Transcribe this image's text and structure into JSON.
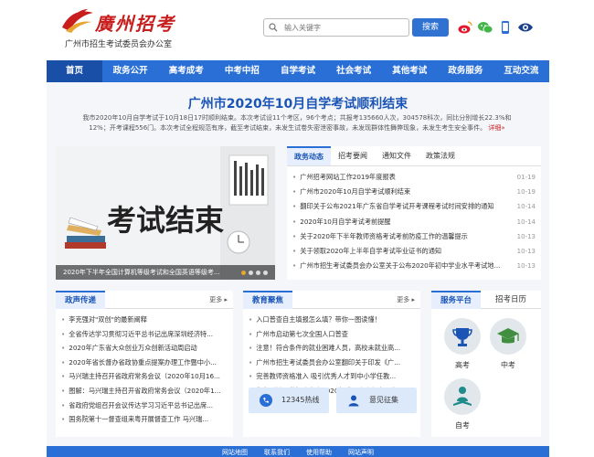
{
  "header": {
    "logo_text": "廣州招考",
    "org_name": "广州市招生考试委员会办公室",
    "search_placeholder": "输入关键字",
    "search_button": "搜索",
    "social_icons": [
      "weibo-icon",
      "wechat-icon",
      "mobile-icon",
      "accessibility-icon"
    ]
  },
  "nav": {
    "items": [
      "首页",
      "政务公开",
      "高考成考",
      "中考中招",
      "自学考试",
      "社会考试",
      "其他考试",
      "政务服务",
      "互动交流"
    ],
    "active_index": 0
  },
  "headline": {
    "title": "广州市2020年10月自学考试顺利结束",
    "summary": "我市2020年10月自学考试于10月18日17时顺利结束。本次考试设11个考区，96个考点；共报考135660人次，304578科次，同比分别增长22.3%和12%；开考课程556门。本次考试全程规范有序，截至考试结束，未发生试卷失密泄密事故，未发现群体性舞弊现象，未发生考生安全事件。",
    "more": "详细»"
  },
  "banner": {
    "image_text": "考试结束",
    "caption": "2020年下半年全国计算机等级考试和全国英语等级考...",
    "slides": 4,
    "active_slide": 0
  },
  "news": {
    "tabs": [
      "政务动态",
      "招考要闻",
      "通知文件",
      "政策法规"
    ],
    "active_tab": 0,
    "more": "更多",
    "items": [
      {
        "title": "广州招考网站工作2019年度报表",
        "date": "01-19"
      },
      {
        "title": "广州市2020年10月自学考试顺利结束",
        "date": "10-19"
      },
      {
        "title": "翻印关于公布2021年广东省自学考试开考课程考试时间安排的通知",
        "date": "10-14"
      },
      {
        "title": "2020年10月自学考试考前提醒",
        "date": "10-14"
      },
      {
        "title": "关于2020年下半年教师资格考试考前防疫工作的温馨提示",
        "date": "10-13"
      },
      {
        "title": "关于领取2020年上半年自学考试毕业证书的通知",
        "date": "10-13"
      },
      {
        "title": "广州市招生考试委员会办公室关于公布2020年初中学业水平考试地...",
        "date": "10-13"
      }
    ]
  },
  "panel_gov": {
    "title": "政声传递",
    "more": "更多",
    "items": [
      "李克强对\"双创\"的最新阐释",
      "全省传达学习贯彻习近平总书记出席深圳经济特...",
      "2020年广东省大众创业万众创新活动周启动",
      "2020年省长督办省政协重点提案办理工作暨中小...",
      "马兴瑞主持召开省政府常务会议（2020年10月16...",
      "图解：马兴瑞主持召开省政府常务会议（2020年1...",
      "省政府党组召开会议传达学习习近平总书记出席...",
      "国务院第十一督查组来粤开展督查工作 马兴瑞..."
    ]
  },
  "panel_edu": {
    "title": "教育聚焦",
    "more": "更多",
    "items": [
      "入口普查自主填报怎么填？带你一图读懂！",
      "广州市启动第七次全国人口普查",
      "注意！符合条件的就业困难人员，高校未就业高...",
      "广州市招生考试委员会办公室翻印关于印发《广...",
      "完善教师资格准入 吸引优秀人才到中小学任教...",
      "翻印《关于做好广东省2020年成人高考报名工作..."
    ],
    "hotline": "12345热线",
    "feedback": "意见征集"
  },
  "panel_platform": {
    "tabs": [
      "服务平台",
      "招考日历"
    ],
    "items": [
      {
        "label": "高考",
        "icon": "trophy-icon"
      },
      {
        "label": "中考",
        "icon": "graduation-cap-icon"
      },
      {
        "label": "自考",
        "icon": "person-book-icon"
      }
    ]
  },
  "footer": {
    "links": [
      "网站地图",
      "联系我们",
      "使用帮助",
      "网站声明"
    ]
  },
  "colors": {
    "brand_blue": "#2a6fd6",
    "nav_active": "#1a4fa8",
    "headline_blue": "#1a55b6",
    "logo_red": "#c81e1e"
  }
}
